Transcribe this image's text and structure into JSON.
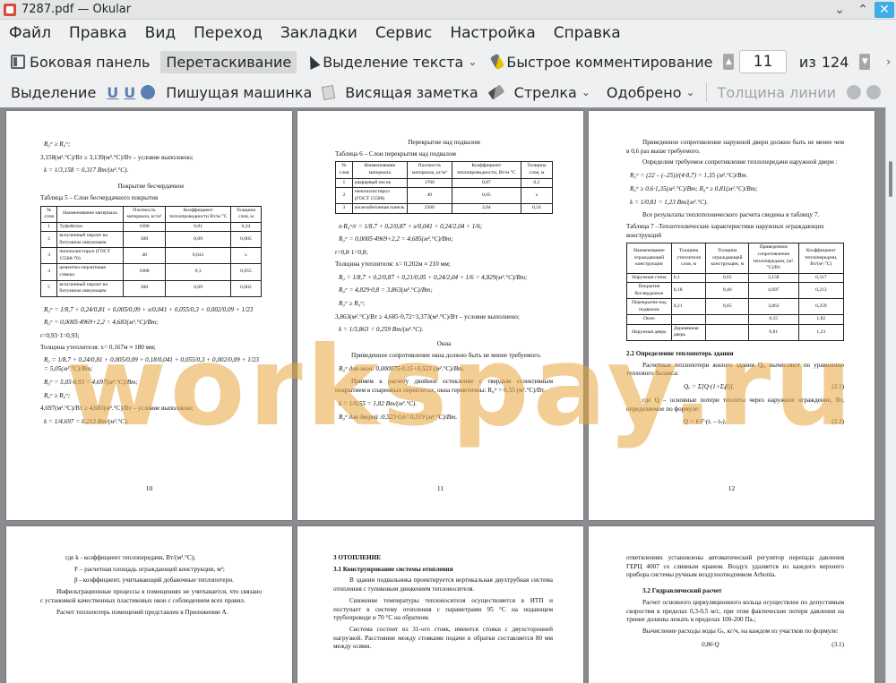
{
  "window": {
    "title": "7287.pdf  — Okular"
  },
  "menu": [
    "Файл",
    "Правка",
    "Вид",
    "Переход",
    "Закладки",
    "Сервис",
    "Настройка",
    "Справка"
  ],
  "toolbar1": {
    "sidebar": "Боковая панель",
    "drag": "Перетаскивание",
    "text_select": "Выделение текста",
    "quick_comment": "Быстрое комментирование",
    "page_current": "11",
    "page_of": "из",
    "page_total": "124"
  },
  "toolbar2": {
    "highlight": "Выделение",
    "typewriter": "Пишущая машинка",
    "note": "Висящая заметка",
    "arrow": "Стрелка",
    "approved": "Одобрено",
    "line_width": "Толщина линии"
  },
  "watermark": "workspay.ru",
  "pages": {
    "p10": {
      "l1": "R₀ᵗʳ ≥ R₀ᵗʳ;",
      "l2": "3,158(м².°С)/Вт ≥ 3,139(м².°С)/Вт – условие выполнено;",
      "l3": "k = 1/3,158 = 0,317 Вт/(м².°С).",
      "h1": "Покрытие бесчердачное",
      "h2": "Таблица 5 – Слои бесчердачного покрытия",
      "th": [
        "№ слоя",
        "Наименование материала",
        "Плотность материала, кг/м³",
        "Коэффициент теплопроводности Вт/м·°С",
        "Толщина слоя, м"
      ],
      "rows": [
        [
          "1",
          "Туфобетон",
          "1600",
          "0,81",
          "0,24"
        ],
        [
          "2",
          "вспученный перлит на битумном связующем",
          "300",
          "0,09",
          "0,005"
        ],
        [
          "3",
          "пенополистирол (ГОСТ 15588-70)",
          "40",
          "0,041",
          "x"
        ],
        [
          "4",
          "цементно-перлитовая стяжка",
          "1000",
          "0,3",
          "0,055"
        ],
        [
          "5",
          "вспученный перлит на битумном связующем",
          "300",
          "0,09",
          "0,002"
        ]
      ],
      "f1": "R₀ᵗʳ = 1/8,7 + 0,24/0,81 + 0,005/0,09 + x/0,041 + 0,055/0,3 + 0,002/0,09 + 1/23",
      "f2": "R₀ᵗʳ = 0,0005·4969+2,2 = 4,683(м².°С)/Вт;",
      "f3": "r=0,93·1=0,93;",
      "f4": "Толщина утеплителя: х= 0,167м ≈ 180 мм;",
      "f5": "R₀ = 1/8,7 + 0,24/0,81 + 0,005/0,09 + 0,18/0,041 + 0,055/0,3 + 0,002/0,09 + 1/23 = 5,05(м².°С)/Вт;",
      "f6": "R₀ᵗʳ = 5,05·0,93 = 4,697(м².°С)/Вт;",
      "f7": "R₀ᵗʳ ≥ R₀ᵗʳ;",
      "f8": "4,697(м².°С)/Вт ≥ 4,683(м².°С)/Вт – условие выполнено;",
      "f9": "k = 1/4,697 = 0,213 Вт/(м².°С).",
      "num": "10"
    },
    "p11": {
      "h1": "Перекрытие над подвалом",
      "h2": "Таблица 6 – Слои перекрытия над подвалом",
      "th": [
        "№ слоя",
        "Наименование материала",
        "Плотность материала, кг/м³",
        "Коэффициент теплопроводности, Вт/м·°С",
        "Толщина слоя, м"
      ],
      "rows": [
        [
          "1",
          "кварцевый песок",
          "1700",
          "0,87",
          "0,2"
        ],
        [
          "2",
          "пенополистирол (ГОСТ 15588)",
          "40",
          "0,05",
          "x"
        ],
        [
          "3",
          "железобетонная панель",
          "2500",
          "2,04",
          "0,24"
        ]
      ],
      "f1": "n·R₀ᵗʳ/r = 1/8,7 + 0,2/0,87 + x/0,041 + 0,24/2,04 + 1/6;",
      "f2": "R₀ᵗʳ = 0,0005·4969+2,2 = 4,685(м².°С)/Вт;",
      "f3": "r=0,8·1=0,8;",
      "f4": "Толщина утеплителя: х= 0,202м ≈ 210 мм;",
      "f5": "R₀ = 1/8,7 + 0,2/0,87 + 0,21/0,05 + 0,24/2,04 + 1/6 = 4,829(м².°С)/Вт;",
      "f6": "R₀ᵗʳ = 4,829·0,8 = 3,863(м².°С)/Вт;",
      "f7": "R₀ᵗʳ ≥ R₀ᵗʳ;",
      "f8": "3,863(м².°С)/Вт ≥ 4,685·0,72=3,373(м².°С)/Вт – условие выполнено;",
      "f9": "k = 1/3,863 = 0,259 Вт/(м².°С).",
      "h3": "Окна",
      "t1": "Приведенное сопротивление окна должно быть не менее требуемого.",
      "t2": "R₀ᵗʳ для окон: 0,000075·0,15+0,523 (м².°С)/Вт.",
      "t3": "Примем к расчету двойное остекление с твердым селективным покрытием в спаренных переплетах, окна герметичны: R₀ᵗʳ = 0,55 (м².°С)/Вт.",
      "t4": "k = 1/0,55 = 1,82 Вт/(м².°С).",
      "t5": "R₀ᵗʳ для дверей :0,523·0,6=0,319 (м².°С)/Вт.",
      "num": "11"
    },
    "p12": {
      "t1": "Приведенное сопротивление наружной двери должно быть не менее чем в 0,6 раз выше требуемого.",
      "t2": "Определим требуемое сопротивление теплопередачи наружной двери :",
      "f1": "R₀ᵗʳ = (22 – (–25))/(4·8,7) = 1,35 (м².°С)/Вт.",
      "f2": "R₀ᵗʳ ≥ 0,6·1,35(м².°С)/Вт; R₀ᵗʳ ≥ 0,81(м².°С)/Вт;",
      "f3": "k = 1/0,81 = 1,23 Вт/(м².°С).",
      "t3": "Все результаты теплотехнического расчета сведены в таблицу 7.",
      "t4": "Таблица 7 –Теплотехнические характеристики наружных ограждающих конструкций",
      "th": [
        "Наименование ограждающей конструкции",
        "Толщина утеплителя слоя, м",
        "Толщина ограждающей конструкции, м",
        "Приведенное сопротивление теплопередачи, (м².°С)/Вт",
        "Коэффициент теплопередачи, Вт/(м².°С)"
      ],
      "rows": [
        [
          "Наружная стена",
          "0,1",
          "0,65",
          "3,158",
          "0,317"
        ],
        [
          "Покрытие бесчердачное",
          "0,18",
          "0,46",
          "4,697",
          "0,213"
        ],
        [
          "Перекрытие над подвалом",
          "0,21",
          "0,65",
          "3,863",
          "0,259"
        ],
        [
          "Окно",
          "",
          "",
          "0,55",
          "1,82"
        ],
        [
          "Наружная дверь",
          "Деревянная дверь",
          "",
          "0,81",
          "1,23"
        ]
      ],
      "h1": "2.2 Определение теплопотерь здания",
      "t5": "Расчетные теплопотери жилого здания Qₒ, вычисляют по уравнению теплового баланса:",
      "f4": "Qₒ = Σ[Q·(1+Σᵢβ)],",
      "f4n": "(2.1)",
      "t6": "где Q – основные потери теплоты через наружное ограждение, Вт, определяемое по формуле:",
      "f5": "Q = k·F·(tᵥ – tₙ),",
      "f5n": "(2.2)",
      "num": "12"
    },
    "p13": {
      "t1": "где k - коэффициент теплопередачи, Вт/(м².°С);",
      "t2": "F – расчетная площадь ограждающей конструкции, м²;",
      "t3": "β - коэффициент, учитывающий добавочные теплопотери.",
      "t4": "Инфильтрационные процессы в помещениях не учитывается, что связано с установкой качественных пластиковых окон с соблюдением всех правил.",
      "t5": "Расчет теплопотерь помещений представлен в Приложении А."
    },
    "p14": {
      "h1": "3 ОТОПЛЕНИЕ",
      "h2": "3.1 Конструирование системы отопления",
      "t1": "В здании подвальника проектируется вертикальная двухтрубная система отопления с тупиковым движением теплоносителя.",
      "t2": "Снижение температуры теплоносителя осуществляется в ИТП и поступает в систему отопления с параметрами 95 °С на подающем трубопроводе и 70 °С на обратном.",
      "t3": "Система состоит из 31-ого стояк, имеются стояки с двухсторонней нагрузкой. Расстояние между стояками подачи и обратки составляется 80 мм между осями."
    },
    "p15": {
      "t1": "ответвлениях установлены автоматический регулятор перепада давления ГЕРЦ 4007 со сливным краном. Воздух удаляется из каждого верхнего прибора системы ручным воздухоотводчиком Arbonia.",
      "h1": "3.2 Гидравлический расчет",
      "t2": "Расчет основного циркуляционного кольца осуществлен по допустимым скоростям в пределах 0,3-0,5 м/с, при этом фактические потери давления на трение должны лежать в пределах 100-200 Па.;",
      "t3": "Вычисление расходы воды Gₜ, кг/ч, на каждом из участков по формуле:",
      "f1": "0,86·Q",
      "f1n": "(3.1)"
    }
  }
}
